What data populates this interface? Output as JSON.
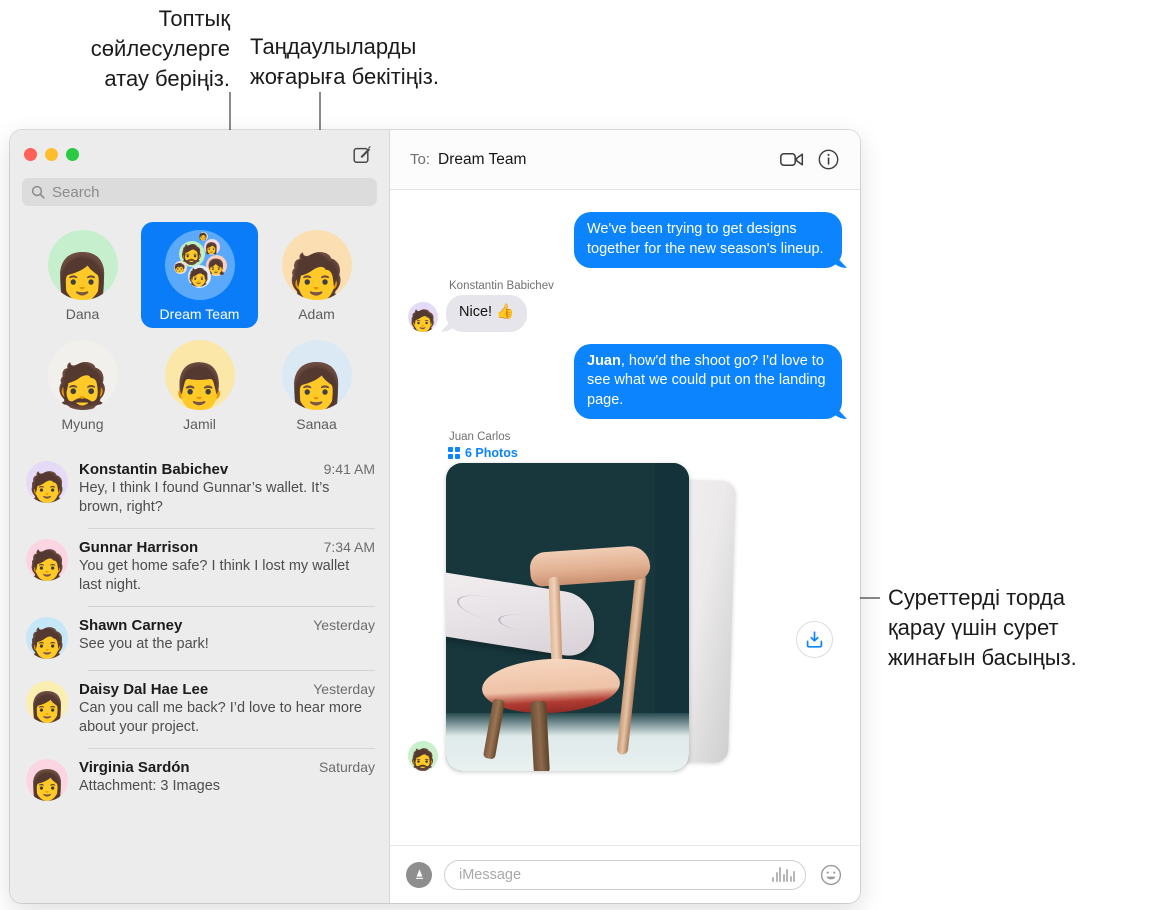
{
  "callouts": {
    "group_name": "Топтық\nсөйлесулерге\nатау беріңіз.",
    "pin_favorites": "Таңдаулыларды\nжоғарыға бекітіңіз.",
    "photo_grid": "Суреттерді торда\nқарау үшін сурет\nжинағын басыңыз."
  },
  "sidebar": {
    "search": {
      "placeholder": "Search",
      "icon": "search-icon"
    },
    "compose_icon": "compose-icon",
    "pinned": [
      {
        "label": "Dana",
        "selected": false,
        "bg": "#c6f0cd",
        "face": "👩"
      },
      {
        "label": "Dream Team",
        "selected": true,
        "bg": "#5aa9fb",
        "face": ""
      },
      {
        "label": "Adam",
        "selected": false,
        "bg": "#fbdfb2",
        "face": "🧑"
      },
      {
        "label": "Myung",
        "selected": false,
        "bg": "#f1f0ec",
        "face": "🧔"
      },
      {
        "label": "Jamil",
        "selected": false,
        "bg": "#fbe8a8",
        "face": "👨"
      },
      {
        "label": "Sanaa",
        "selected": false,
        "bg": "#dbe9f5",
        "face": "👩"
      }
    ],
    "conversations": [
      {
        "name": "Konstantin Babichev",
        "time": "9:41 AM",
        "preview": "Hey, I think I found Gunnar’s wallet. It’s brown, right?",
        "bg": "#e5dbf7",
        "face": "🧑"
      },
      {
        "name": "Gunnar Harrison",
        "time": "7:34 AM",
        "preview": "You get home safe? I think I lost my wallet last night.",
        "bg": "#fbd6e2",
        "face": "🧑"
      },
      {
        "name": "Shawn Carney",
        "time": "Yesterday",
        "preview": "See you at the park!",
        "bg": "#c5e7f7",
        "face": "🧑"
      },
      {
        "name": "Daisy Dal Hae Lee",
        "time": "Yesterday",
        "preview": "Can you call me back? I’d love to hear more about your project.",
        "bg": "#fbeeb1",
        "face": "👩"
      },
      {
        "name": "Virginia Sardón",
        "time": "Saturday",
        "preview": "Attachment: 3 Images",
        "bg": "#fbd6e2",
        "face": "👩"
      }
    ]
  },
  "conversation": {
    "to_label": "To:",
    "to_value": "Dream Team",
    "facetime_icon": "video-camera-icon",
    "details_icon": "info-icon",
    "messages": [
      {
        "direction": "out",
        "text": "We've been trying to get designs together for the new season's lineup."
      },
      {
        "direction": "in",
        "sender": "Konstantin Babichev",
        "text": "Nice!  👍",
        "avatar_bg": "#e5dbf7",
        "avatar_face": "🧑"
      },
      {
        "direction": "out",
        "highlight": "Juan",
        "text": ", how'd the shoot go? I'd love to see what we could put on the landing page."
      },
      {
        "direction": "in",
        "sender": "Juan Carlos",
        "attachment_label": "6 Photos",
        "attachment_icon": "photo-grid-icon",
        "download_icon": "download-icon",
        "avatar_bg": "#c8f0cb",
        "avatar_face": "🧔"
      }
    ],
    "composer": {
      "apps_icon": "app-store-icon",
      "input_placeholder": "iMessage",
      "audio_icon": "audio-waveform-icon",
      "emoji_icon": "emoji-smiley-icon"
    }
  },
  "colors": {
    "accent_blue": "#0b84fe",
    "bubble_in": "#e6e5eb",
    "sidebar_bg": "#ececec",
    "traffic_red": "#ff6159",
    "traffic_yellow": "#ffbd2e",
    "traffic_green": "#2bca42"
  }
}
